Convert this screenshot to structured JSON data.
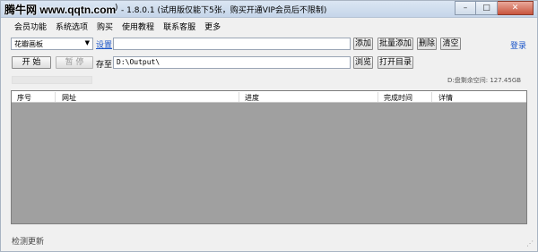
{
  "titlebar": {
    "watermark": "腾牛网 www.qqtn.com",
    "paren": ")",
    "title": "- 1.8.0.1 (试用版仅能下5张，购买开通VIP会员后不限制)",
    "minimize": "–",
    "maximize": "□",
    "close": "✕"
  },
  "menu": [
    "会员功能",
    "系统选项",
    "购买",
    "使用教程",
    "联系客服",
    "更多"
  ],
  "toolbar": {
    "source_select": "花瓣画板",
    "settings_link": "设置",
    "url_value": "",
    "add": "添加",
    "batch_add": "批量添加",
    "delete": "删除",
    "clear": "清空",
    "login": "登录"
  },
  "controls": {
    "start": "开 始",
    "pause": "暂 停",
    "save_to_label": "存至",
    "path_value": "D:\\Output\\",
    "browse": "浏览",
    "open_folder": "打开目录"
  },
  "progress": {
    "percent": 0
  },
  "disk": "D:盘剩余空间: 127.45GB",
  "list": {
    "columns": [
      "序号",
      "网址",
      "进度",
      "完成时间",
      "详情"
    ],
    "rows": []
  },
  "status": {
    "check_update": "检测更新"
  },
  "colors": {
    "link": "#1a55c9",
    "list_bg": "#a0a0a0"
  }
}
